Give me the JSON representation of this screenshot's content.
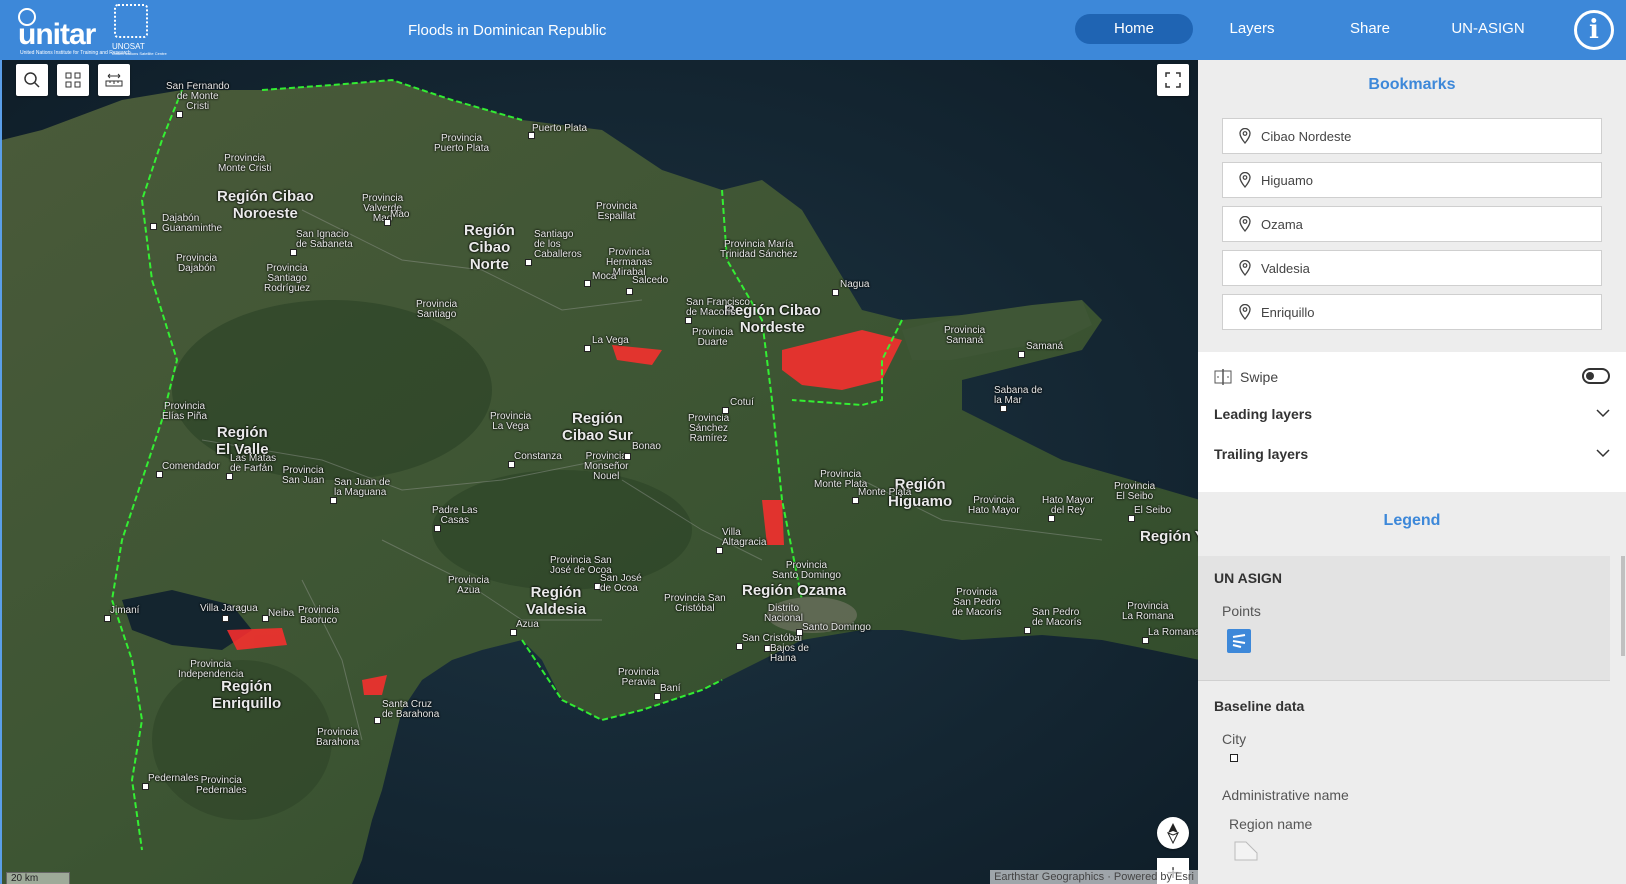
{
  "header": {
    "unitar_logo_text": "unitar",
    "unitar_tagline": "United Nations Institute for Training and Research",
    "unosat_logo_text": "UNOSAT",
    "unosat_tagline": "United Nations Satellite Centre",
    "title": "Floods in Dominican Republic",
    "nav": {
      "home": "Home",
      "layers": "Layers",
      "share": "Share",
      "unasign": "UN-ASIGN"
    },
    "info_label": "i"
  },
  "map": {
    "attribution": "Earthstar Geographics · Powered by Esri",
    "scale": "20 km",
    "regions": [
      {
        "text": "Región Cibao\nNoroeste"
      },
      {
        "text": "Región\nCibao\nNorte"
      },
      {
        "text": "Región Cibao\nNordeste"
      },
      {
        "text": "Región\nEl Valle"
      },
      {
        "text": "Región\nCibao Sur"
      },
      {
        "text": "Región\nHiguamo"
      },
      {
        "text": "Región Ozama"
      },
      {
        "text": "Región\nValdesia"
      },
      {
        "text": "Región\nEnriquillo"
      },
      {
        "text": "Región Y"
      }
    ],
    "provinces": [
      {
        "text": "Provincia\nPuerto Plata"
      },
      {
        "text": "Provincia\nMonte Cristi"
      },
      {
        "text": "Provincia\nValverde\nMao"
      },
      {
        "text": "Provincia\nEspaillat"
      },
      {
        "text": "Provincia María\nTrinidad Sánchez"
      },
      {
        "text": "Provincia\nHermanas\nMirabal"
      },
      {
        "text": "Provincia\nSantiago\nRodríguez"
      },
      {
        "text": "Provincia\nDajabón"
      },
      {
        "text": "Provincia\nSantiago"
      },
      {
        "text": "Provincia\nDuarte"
      },
      {
        "text": "Provincia\nSamaná"
      },
      {
        "text": "Provincia\nElías Piña"
      },
      {
        "text": "Provincia\nLa Vega"
      },
      {
        "text": "Provincia\nSánchez\nRamírez"
      },
      {
        "text": "Provincia\nMonseñor\nNouel"
      },
      {
        "text": "Provincia\nSan Juan"
      },
      {
        "text": "Provincia\nMonte Plata"
      },
      {
        "text": "Provincia\nHato Mayor"
      },
      {
        "text": "Provincia\nEl Seibo"
      },
      {
        "text": "Provincia San\nJosé de Ocoa"
      },
      {
        "text": "Provincia\nAzua"
      },
      {
        "text": "Provincia San\nCristóbal"
      },
      {
        "text": "Provincia\nSanto Domingo"
      },
      {
        "text": "Distrito\nNacional"
      },
      {
        "text": "Provincia\nSan Pedro\nde Macorís"
      },
      {
        "text": "Provincia\nLa Romana"
      },
      {
        "text": "Provincia\nBaoruco"
      },
      {
        "text": "Provincia\nIndependencia"
      },
      {
        "text": "Provincia\nPeravia"
      },
      {
        "text": "Provincia\nBarahona"
      },
      {
        "text": "Provincia\nPedernales"
      }
    ],
    "cities": [
      {
        "text": "San Fernando\nde Monte\nCristi"
      },
      {
        "text": "Puerto Plata"
      },
      {
        "text": "Dajabón\nGuanaminthe"
      },
      {
        "text": "Mao"
      },
      {
        "text": "San Ignacio\nde Sabaneta"
      },
      {
        "text": "Santiago\nde los\nCaballeros"
      },
      {
        "text": "Moca"
      },
      {
        "text": "Salcedo"
      },
      {
        "text": "Nagua"
      },
      {
        "text": "San Francisco\nde Macorís"
      },
      {
        "text": "La Vega"
      },
      {
        "text": "Samaná"
      },
      {
        "text": "Cotuí"
      },
      {
        "text": "Sabana de\nla Mar"
      },
      {
        "text": "Bonao"
      },
      {
        "text": "Constanza"
      },
      {
        "text": "Comendador"
      },
      {
        "text": "Las Matas\nde Farfán"
      },
      {
        "text": "San Juan de\nla Maguana"
      },
      {
        "text": "Padre Las\nCasas"
      },
      {
        "text": "Monte Plata"
      },
      {
        "text": "Hato Mayor\ndel Rey"
      },
      {
        "text": "El Seibo"
      },
      {
        "text": "Villa\nAltagracia"
      },
      {
        "text": "San José\nde Ocoa"
      },
      {
        "text": "Jimaní"
      },
      {
        "text": "Villa Jaragua"
      },
      {
        "text": "Neiba"
      },
      {
        "text": "Azua"
      },
      {
        "text": "San Cristóbal"
      },
      {
        "text": "Bajos de\nHaina"
      },
      {
        "text": "Santo Domingo"
      },
      {
        "text": "San Pedro\nde Macorís"
      },
      {
        "text": "La Romana"
      },
      {
        "text": "Baní"
      },
      {
        "text": "Santa Cruz\nde Barahona"
      },
      {
        "text": "Pedernales"
      }
    ]
  },
  "panel": {
    "bookmarks_title": "Bookmarks",
    "bookmarks": [
      "Cibao Nordeste",
      "Higuamo",
      "Ozama",
      "Valdesia",
      "Enriquillo"
    ],
    "swipe_label": "Swipe",
    "leading_layers": "Leading layers",
    "trailing_layers": "Trailing layers",
    "legend_title": "Legend",
    "legend": {
      "group1": "UN ASIGN",
      "group1_item": "Points",
      "group2": "Baseline data",
      "city": "City",
      "admin_name": "Administrative name",
      "region_name": "Region name"
    }
  },
  "colors": {
    "header": "#3d88d9",
    "nav_active": "#1f64b3",
    "flood": "#ff2e2e",
    "boundary": "#33ff33"
  }
}
